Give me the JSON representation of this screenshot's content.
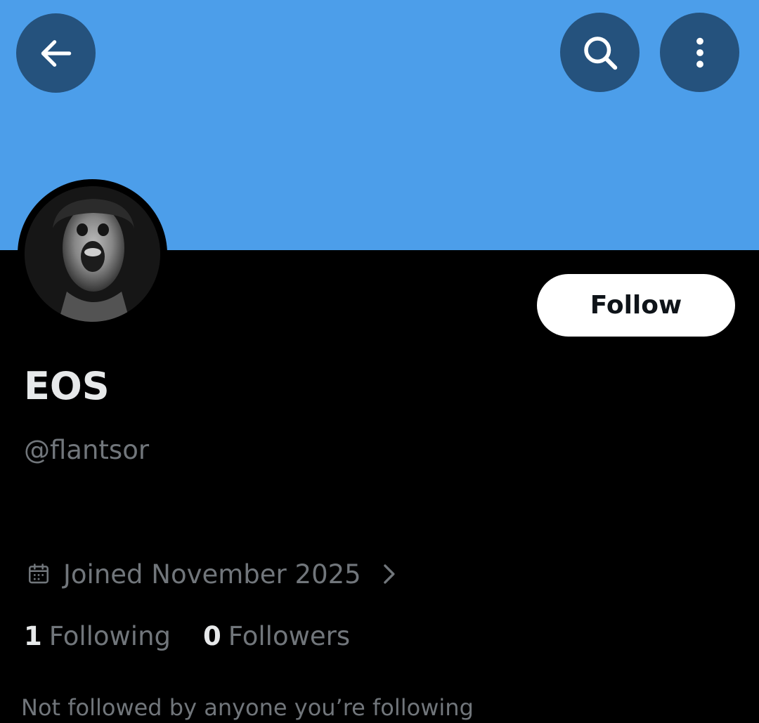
{
  "banner": {
    "color": "#4c9eea"
  },
  "header": {
    "back_icon": "arrow-left-icon",
    "search_icon": "search-icon",
    "more_icon": "more-vertical-icon"
  },
  "profile": {
    "display_name": "EOS",
    "handle": "@flantsor",
    "follow_label": "Follow",
    "joined_icon": "calendar-icon",
    "joined_text": "Joined November 2025",
    "following_count": "1",
    "following_label": "Following",
    "followers_count": "0",
    "followers_label": "Followers",
    "not_followed_text": "Not followed by anyone you’re following"
  },
  "colors": {
    "background": "#000000",
    "primary_text": "#e7e9ea",
    "secondary_text": "#71767b",
    "header_button": "#25527d",
    "follow_button_bg": "#ffffff",
    "follow_button_text": "#0f1419"
  }
}
